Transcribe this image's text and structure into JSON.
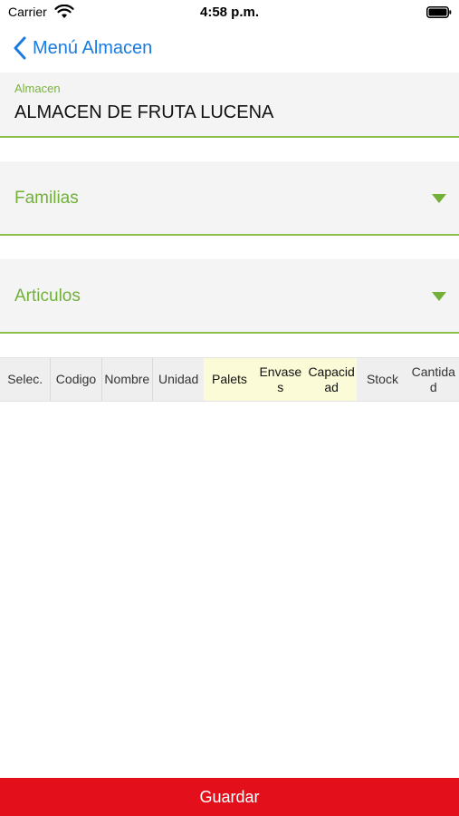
{
  "status_bar": {
    "carrier": "Carrier",
    "time": "4:58 p.m."
  },
  "nav": {
    "back_label": "Menú Almacen"
  },
  "almacen_field": {
    "label": "Almacen",
    "value": "ALMACEN DE FRUTA LUCENA"
  },
  "familias_picker": {
    "label": "Familias"
  },
  "articulos_picker": {
    "label": "Articulos"
  },
  "table": {
    "columns": [
      {
        "label": "Selec.",
        "highlight": false
      },
      {
        "label": "Codigo",
        "highlight": false
      },
      {
        "label": "Nombre",
        "highlight": false
      },
      {
        "label": "Unidad",
        "highlight": false
      },
      {
        "label": "Palets",
        "highlight": true
      },
      {
        "label": "Envases",
        "highlight": true
      },
      {
        "label": "Capacidad",
        "highlight": true
      },
      {
        "label": "Stock",
        "highlight": false
      },
      {
        "label": "Cantidad",
        "highlight": false
      }
    ],
    "rows": []
  },
  "save_button": {
    "label": "Guardar"
  },
  "colors": {
    "accent_green": "#72b03a",
    "link_blue": "#1a7be0",
    "save_red": "#e3101c",
    "highlight_yellow": "#fbfbd8"
  },
  "icons": [
    "wifi-icon",
    "battery-icon",
    "chevron-left-icon",
    "caret-down-icon"
  ]
}
